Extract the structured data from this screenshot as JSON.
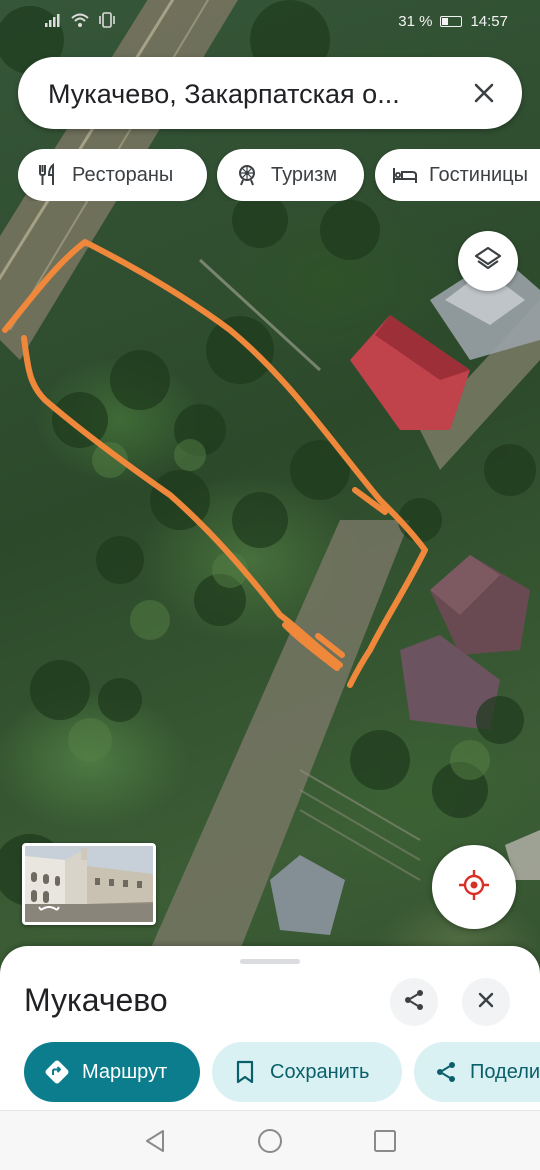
{
  "status_bar": {
    "battery": "31 %",
    "time": "14:57"
  },
  "search": {
    "query": "Мукачево, Закарпатская о..."
  },
  "chips": [
    {
      "label": "Рестораны",
      "icon": "restaurant-icon"
    },
    {
      "label": "Туризм",
      "icon": "tourism-icon"
    },
    {
      "label": "Гостиницы",
      "icon": "hotel-icon"
    }
  ],
  "place": {
    "title": "Мукачево"
  },
  "actions": {
    "route": "Маршрут",
    "save": "Сохранить",
    "share": "Подели"
  },
  "colors": {
    "accent": "#0b7d8c",
    "accent_light": "#d9f1f3",
    "annotation": "#f0883c",
    "location": "#d93025"
  }
}
